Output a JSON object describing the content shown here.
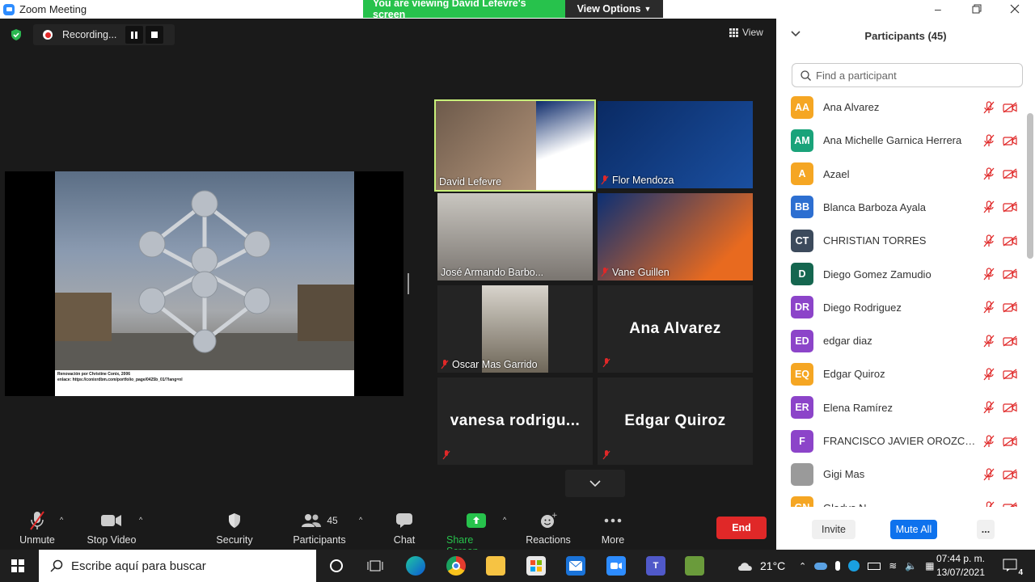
{
  "window": {
    "title": "Zoom Meeting",
    "viewing_banner": "You are viewing David Lefevre's screen",
    "view_options": "View Options"
  },
  "recording": {
    "label": "Recording..."
  },
  "view_button": "View",
  "shared_slide": {
    "caption_line1": "Renovación por Christine Conix, 2006",
    "caption_line2": "enlace: https://conixrdbm.com/portfolio_page/0425b_01/?lang=nl"
  },
  "tiles": [
    {
      "name": "David Lefevre",
      "active": true,
      "muted": false
    },
    {
      "name": "Flor Mendoza",
      "muted": true
    },
    {
      "name": "José Armando Barbo...",
      "muted": false
    },
    {
      "name": "Vane Guillen",
      "muted": true
    },
    {
      "name": "Oscar Mas Garrido",
      "muted": true
    },
    {
      "name": "Ana Alvarez",
      "muted": true
    },
    {
      "name": "vanesa  rodrigu...",
      "muted": true
    },
    {
      "name": "Edgar Quiroz",
      "muted": true
    }
  ],
  "toolbar": {
    "unmute": "Unmute",
    "stop_video": "Stop Video",
    "security": "Security",
    "participants": "Participants",
    "participants_count": "45",
    "chat": "Chat",
    "share_screen": "Share Screen",
    "reactions": "Reactions",
    "more": "More",
    "end": "End"
  },
  "panel": {
    "title": "Participants (45)",
    "search_placeholder": "Find a participant",
    "participants": [
      {
        "initials": "AA",
        "name": "Ana Alvarez",
        "color": "#f5a623"
      },
      {
        "initials": "AM",
        "name": "Ana Michelle Garnica Herrera",
        "color": "#1aa37a"
      },
      {
        "initials": "A",
        "name": "Azael",
        "color": "#f5a623"
      },
      {
        "initials": "BB",
        "name": "Blanca Barboza Ayala",
        "color": "#2d6fd1"
      },
      {
        "initials": "CT",
        "name": "CHRISTIAN TORRES",
        "color": "#3c4a5c"
      },
      {
        "initials": "D",
        "name": "Diego Gomez Zamudio",
        "color": "#15664f"
      },
      {
        "initials": "DR",
        "name": "Diego Rodriguez",
        "color": "#8c44c9"
      },
      {
        "initials": "ED",
        "name": "edgar diaz",
        "color": "#8c44c9"
      },
      {
        "initials": "EQ",
        "name": "Edgar Quiroz",
        "color": "#f5a623"
      },
      {
        "initials": "ER",
        "name": "Elena Ramírez",
        "color": "#8c44c9"
      },
      {
        "initials": "F",
        "name": "FRANCISCO JAVIER OROZCO R...",
        "color": "#8c44c9"
      },
      {
        "initials": "",
        "name": "Gigi Mas",
        "color": "#9a9a9a"
      },
      {
        "initials": "GN",
        "name": "Gladys N...",
        "color": "#f5a623"
      }
    ],
    "invite": "Invite",
    "mute_all": "Mute All",
    "more": "..."
  },
  "taskbar": {
    "search_placeholder": "Escribe aquí para buscar",
    "temperature": "21°C",
    "time": "07:44 p. m.",
    "date": "13/07/2021",
    "notifications": "4"
  }
}
